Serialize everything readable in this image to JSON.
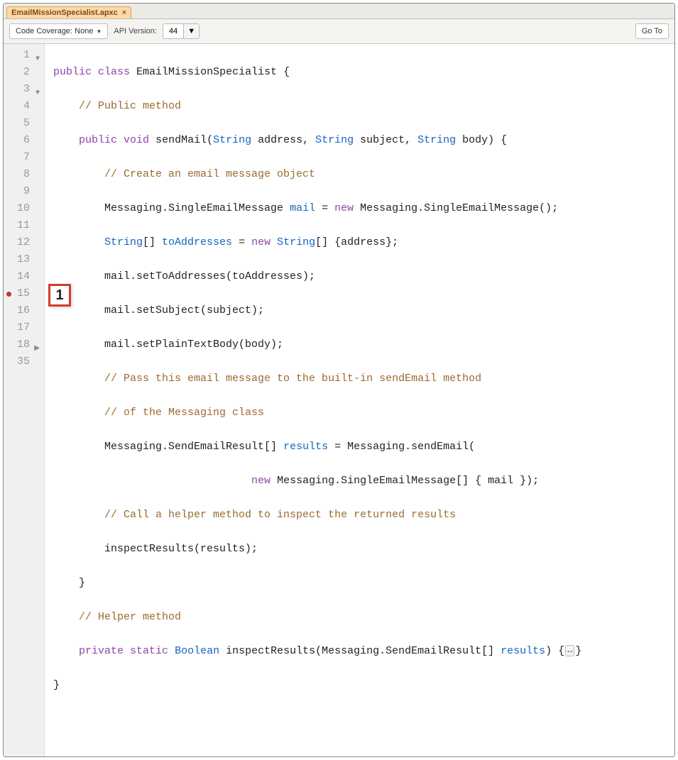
{
  "tab": {
    "title": "EmailMissionSpecialist.apxc",
    "close": "×"
  },
  "toolbar": {
    "coverage_label": "Code Coverage: None",
    "api_label": "API Version:",
    "api_value": "44",
    "goto": "Go To"
  },
  "callout": "1",
  "lines": {
    "l1": "1",
    "l2": "2",
    "l3": "3",
    "l4": "4",
    "l5": "5",
    "l6": "6",
    "l7": "7",
    "l8": "8",
    "l9": "9",
    "l10": "10",
    "l11": "11",
    "l12": "12",
    "l13": "13",
    "l14": "14",
    "l15": "15",
    "l16": "16",
    "l17": "17",
    "l18": "18",
    "l35": "35"
  },
  "code": {
    "c1_a": "public",
    "c1_b": "class",
    "c1_c": " EmailMissionSpecialist {",
    "c2": "    // Public method",
    "c3_a": "public",
    "c3_b": "void",
    "c3_c": " sendMail(",
    "c3_d": "String",
    "c3_e": " address, ",
    "c3_f": "String",
    "c3_g": " subject, ",
    "c3_h": "String",
    "c3_i": " body) {",
    "c4": "        // Create an email message object",
    "c5_a": "        Messaging.SingleEmailMessage ",
    "c5_b": "mail",
    "c5_c": " = ",
    "c5_d": "new",
    "c5_e": " Messaging.SingleEmailMessage();",
    "c6_a": "        ",
    "c6_b": "String",
    "c6_c": "[] ",
    "c6_d": "toAddresses",
    "c6_e": " = ",
    "c6_f": "new",
    "c6_g": " ",
    "c6_h": "String",
    "c6_i": "[] {address};",
    "c7": "        mail.setToAddresses(toAddresses);",
    "c8": "        mail.setSubject(subject);",
    "c9": "        mail.setPlainTextBody(body);",
    "c10": "        // Pass this email message to the built-in sendEmail method",
    "c11": "        // of the Messaging class",
    "c12_a": "        Messaging.SendEmailResult[] ",
    "c12_b": "results",
    "c12_c": " = Messaging.sendEmail(",
    "c13_a": "                               ",
    "c13_b": "new",
    "c13_c": " Messaging.SingleEmailMessage[] { mail });",
    "c14": "        // Call a helper method to inspect the returned results",
    "c15": "        inspectResults(results);",
    "c16": "    }",
    "c17": "    // Helper method",
    "c18_a": "private",
    "c18_b": "static",
    "c18_c": "Boolean",
    "c18_d": " inspectResults(Messaging.SendEmailResult[] ",
    "c18_e": "results",
    "c18_f": ") {",
    "c18_g": "↔",
    "c18_h": "}",
    "c35": "}"
  }
}
